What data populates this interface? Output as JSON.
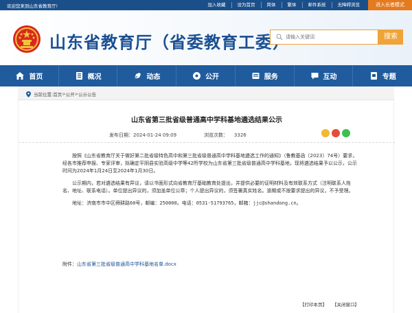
{
  "topbar": {
    "welcome": "欢迎您来到山东省教育厅!",
    "links": [
      "加入收藏",
      "设为首页",
      "简体",
      "繁体",
      "邮件系统",
      "无障碍浏览"
    ],
    "elder_mode": "进入长者模式"
  },
  "header": {
    "site_title": "山东省教育厅（省委教育工委）",
    "search_placeholder": "请输入关键词",
    "search_button": "搜索"
  },
  "nav": [
    {
      "label": "首页",
      "icon": "home-icon"
    },
    {
      "label": "概况",
      "icon": "book-icon"
    },
    {
      "label": "动态",
      "icon": "news-icon"
    },
    {
      "label": "公开",
      "icon": "folder-icon"
    },
    {
      "label": "服务",
      "icon": "service-icon"
    },
    {
      "label": "互动",
      "icon": "chat-icon"
    },
    {
      "label": "专题",
      "icon": "topic-icon"
    }
  ],
  "breadcrumb": {
    "prefix": "当前位置:",
    "items": [
      "首页",
      "公开",
      "公示公告"
    ],
    "separator": " > "
  },
  "article": {
    "title": "山东省第三批省级普通高中学科基地遴选结果公示",
    "publish_label": "发布日期：",
    "publish_date": "2024-01-24 09:09",
    "views_label": "浏览次数：",
    "views": "3326",
    "paragraph1": "按照《山东省教育厅关于做好第二批省级特色高中和第三批省级普通高中学科基地遴选工作的通知》（鲁教基函〔2023〕74号）要求，经各市推荐申报、专家评审，拟确定平阴县实验高级中学等42所学校为山东省第三批省级普通高中学科基地，现将遴选结果予以公示，公示时间为2024年1月24日至2024年1月30日。",
    "paragraph2": "公示期内，若对遴选结果有异议，请以书面形式向省教育厅基础教育处提出，并提供必要的证明材料及有效联系方式（注明联系人姓名、地址、联系电话）。单位提出异议的，须加盖单位公章；个人提出异议的，须签署真实姓名。逾期或不按要求提出的异议，不予受理。",
    "address": "地址：济南市市中区舜耕路60号，邮编：250000。电话：0531-51793765，邮箱：jjc@shandong.cn。",
    "attachment_label": "附件：",
    "attachment_link": "山东省第三批省级普通高中学科基地名单.docx",
    "print": "【打印本页】",
    "close": "【关闭窗口】"
  },
  "colors": {
    "brand_blue": "#1f5b9d",
    "title_blue": "#1a4f93",
    "accent_orange": "#f0a437"
  }
}
